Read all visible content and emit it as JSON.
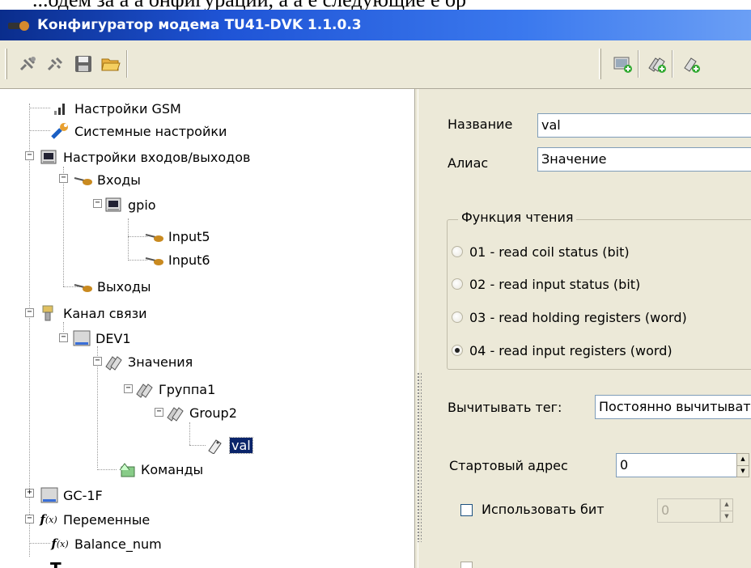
{
  "doc_fragment": "...одем за  а  а  онфигурации,  а  а  е следующие  е  ор",
  "window": {
    "title": "Конфигуратор модема TU41-DVK 1.1.0.3"
  },
  "toolbar": {
    "left_icons": [
      "connect-icon",
      "disconnect-icon",
      "save-icon",
      "open-folder-icon"
    ],
    "right_icons": [
      "add-device-icon",
      "add-tag-group-icon",
      "add-tag-icon"
    ]
  },
  "tree": {
    "nodes": [
      {
        "label": "Настройки GSM",
        "icon": "signal-icon"
      },
      {
        "label": "Системные настройки",
        "icon": "wrench-icon"
      },
      {
        "label": "Настройки входов/выходов",
        "icon": "chip-icon"
      },
      {
        "label": "Входы",
        "icon": "plug-icon"
      },
      {
        "label": "gpio",
        "icon": "chip-icon"
      },
      {
        "label": "Input5",
        "icon": "plug-icon"
      },
      {
        "label": "Input6",
        "icon": "plug-icon"
      },
      {
        "label": "Выходы",
        "icon": "plug-icon"
      },
      {
        "label": "Канал связи",
        "icon": "connector-icon"
      },
      {
        "label": "DEV1",
        "icon": "device-icon"
      },
      {
        "label": "Значения",
        "icon": "tags-icon"
      },
      {
        "label": "Группа1",
        "icon": "tags-icon"
      },
      {
        "label": "Group2",
        "icon": "tags-icon"
      },
      {
        "label": "val",
        "icon": "tag-icon"
      },
      {
        "label": "Команды",
        "icon": "commands-icon"
      },
      {
        "label": "GC-1F",
        "icon": "device-icon"
      },
      {
        "label": "Переменные",
        "icon": "function-icon"
      },
      {
        "label": "Balance_num",
        "icon": "function-icon"
      }
    ]
  },
  "form": {
    "name_label": "Название",
    "name_value": "val",
    "alias_label": "Алиас",
    "alias_value": "Значение",
    "read_function_title": "Функция чтения",
    "read_options": [
      "01 - read coil status (bit)",
      "02 - read input status (bit)",
      "03 - read holding registers (word)",
      "04 - read input registers (word)"
    ],
    "selected_read_option": "04 - read input registers (word)",
    "read_tag_label": "Вычитывать тег:",
    "read_tag_value": "Постоянно вычитывать",
    "start_address_label": "Стартовый адрес",
    "start_address_value": "0",
    "use_bit_label": "Использовать бит",
    "use_bit_checked": false,
    "bit_value": "0"
  }
}
